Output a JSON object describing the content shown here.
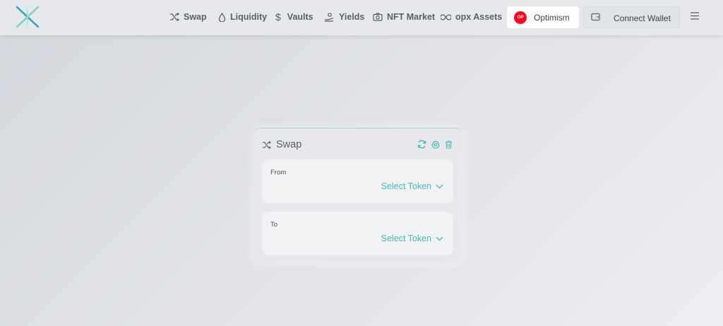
{
  "header": {
    "logo_icon": "x-logo-icon",
    "nav": [
      {
        "label": "Swap",
        "icon": "shuffle-icon"
      },
      {
        "label": "Liquidity",
        "icon": "droplet-icon"
      },
      {
        "label": "Vaults",
        "icon": "dollar-icon"
      },
      {
        "label": "Yields",
        "icon": "hand-coin-icon"
      },
      {
        "label": "NFT Market",
        "icon": "camera-icon"
      },
      {
        "label": "opx Assets",
        "icon": "infinity-icon"
      }
    ],
    "network": {
      "badge": "OP",
      "label": "Optimism",
      "color": "#ff0420"
    },
    "wallet": {
      "label": "Connect Wallet",
      "icon": "wallet-icon"
    },
    "menu_icon": "hamburger-icon"
  },
  "swap_card": {
    "title": "Swap",
    "title_icon": "shuffle-icon",
    "actions": [
      "refresh-icon",
      "settings-icon",
      "trash-icon"
    ],
    "from": {
      "label": "From",
      "select": "Select Token"
    },
    "to": {
      "label": "To",
      "select": "Select Token"
    },
    "accent": "#4cb7b3"
  }
}
